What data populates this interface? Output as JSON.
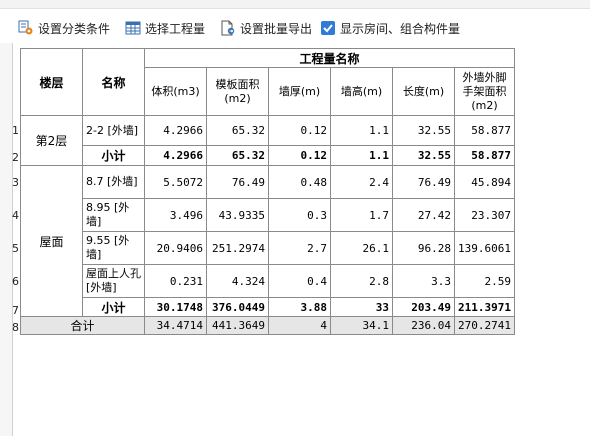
{
  "toolbar": {
    "items": [
      {
        "label": "设置分类条件",
        "icon": "gear-settings-icon"
      },
      {
        "label": "选择工程量",
        "icon": "table-grid-icon"
      },
      {
        "label": "设置批量导出",
        "icon": "document-export-icon"
      },
      {
        "label": "显示房间、组合构件量",
        "icon": "checkbox-checked-icon",
        "checked": true
      }
    ]
  },
  "table": {
    "headers": {
      "floor": "楼层",
      "name": "名称",
      "group": "工程量名称",
      "columns": [
        "体积(m3)",
        "模板面积(m2)",
        "墙厚(m)",
        "墙高(m)",
        "长度(m)",
        "外墙外脚手架面积(m2)"
      ]
    },
    "row_numbers": [
      "1",
      "2",
      "3",
      "4",
      "5",
      "6",
      "7",
      "8"
    ],
    "floors": [
      "第2层",
      "屋面"
    ],
    "rows": [
      {
        "name": "2-2 [外墙]",
        "values": [
          "4.2966",
          "65.32",
          "0.12",
          "1.1",
          "32.55",
          "58.877"
        ]
      },
      {
        "name": "小计",
        "values": [
          "4.2966",
          "65.32",
          "0.12",
          "1.1",
          "32.55",
          "58.877"
        ]
      },
      {
        "name": "8.7 [外墙]",
        "values": [
          "5.5072",
          "76.49",
          "0.48",
          "2.4",
          "76.49",
          "45.894"
        ]
      },
      {
        "name": "8.95 [外墙]",
        "values": [
          "3.496",
          "43.9335",
          "0.3",
          "1.7",
          "27.42",
          "23.307"
        ]
      },
      {
        "name": "9.55 [外墙]",
        "values": [
          "20.9406",
          "251.2974",
          "2.7",
          "26.1",
          "96.28",
          "139.6061"
        ]
      },
      {
        "name": "屋面上人孔 [外墙]",
        "values": [
          "0.231",
          "4.324",
          "0.4",
          "2.8",
          "3.3",
          "2.59"
        ]
      },
      {
        "name": "小计",
        "values": [
          "30.1748",
          "376.0449",
          "3.88",
          "33",
          "203.49",
          "211.3971"
        ]
      }
    ],
    "total": {
      "label": "合计",
      "values": [
        "34.4714",
        "441.3649",
        "4",
        "34.1",
        "236.04",
        "270.2741"
      ]
    }
  }
}
